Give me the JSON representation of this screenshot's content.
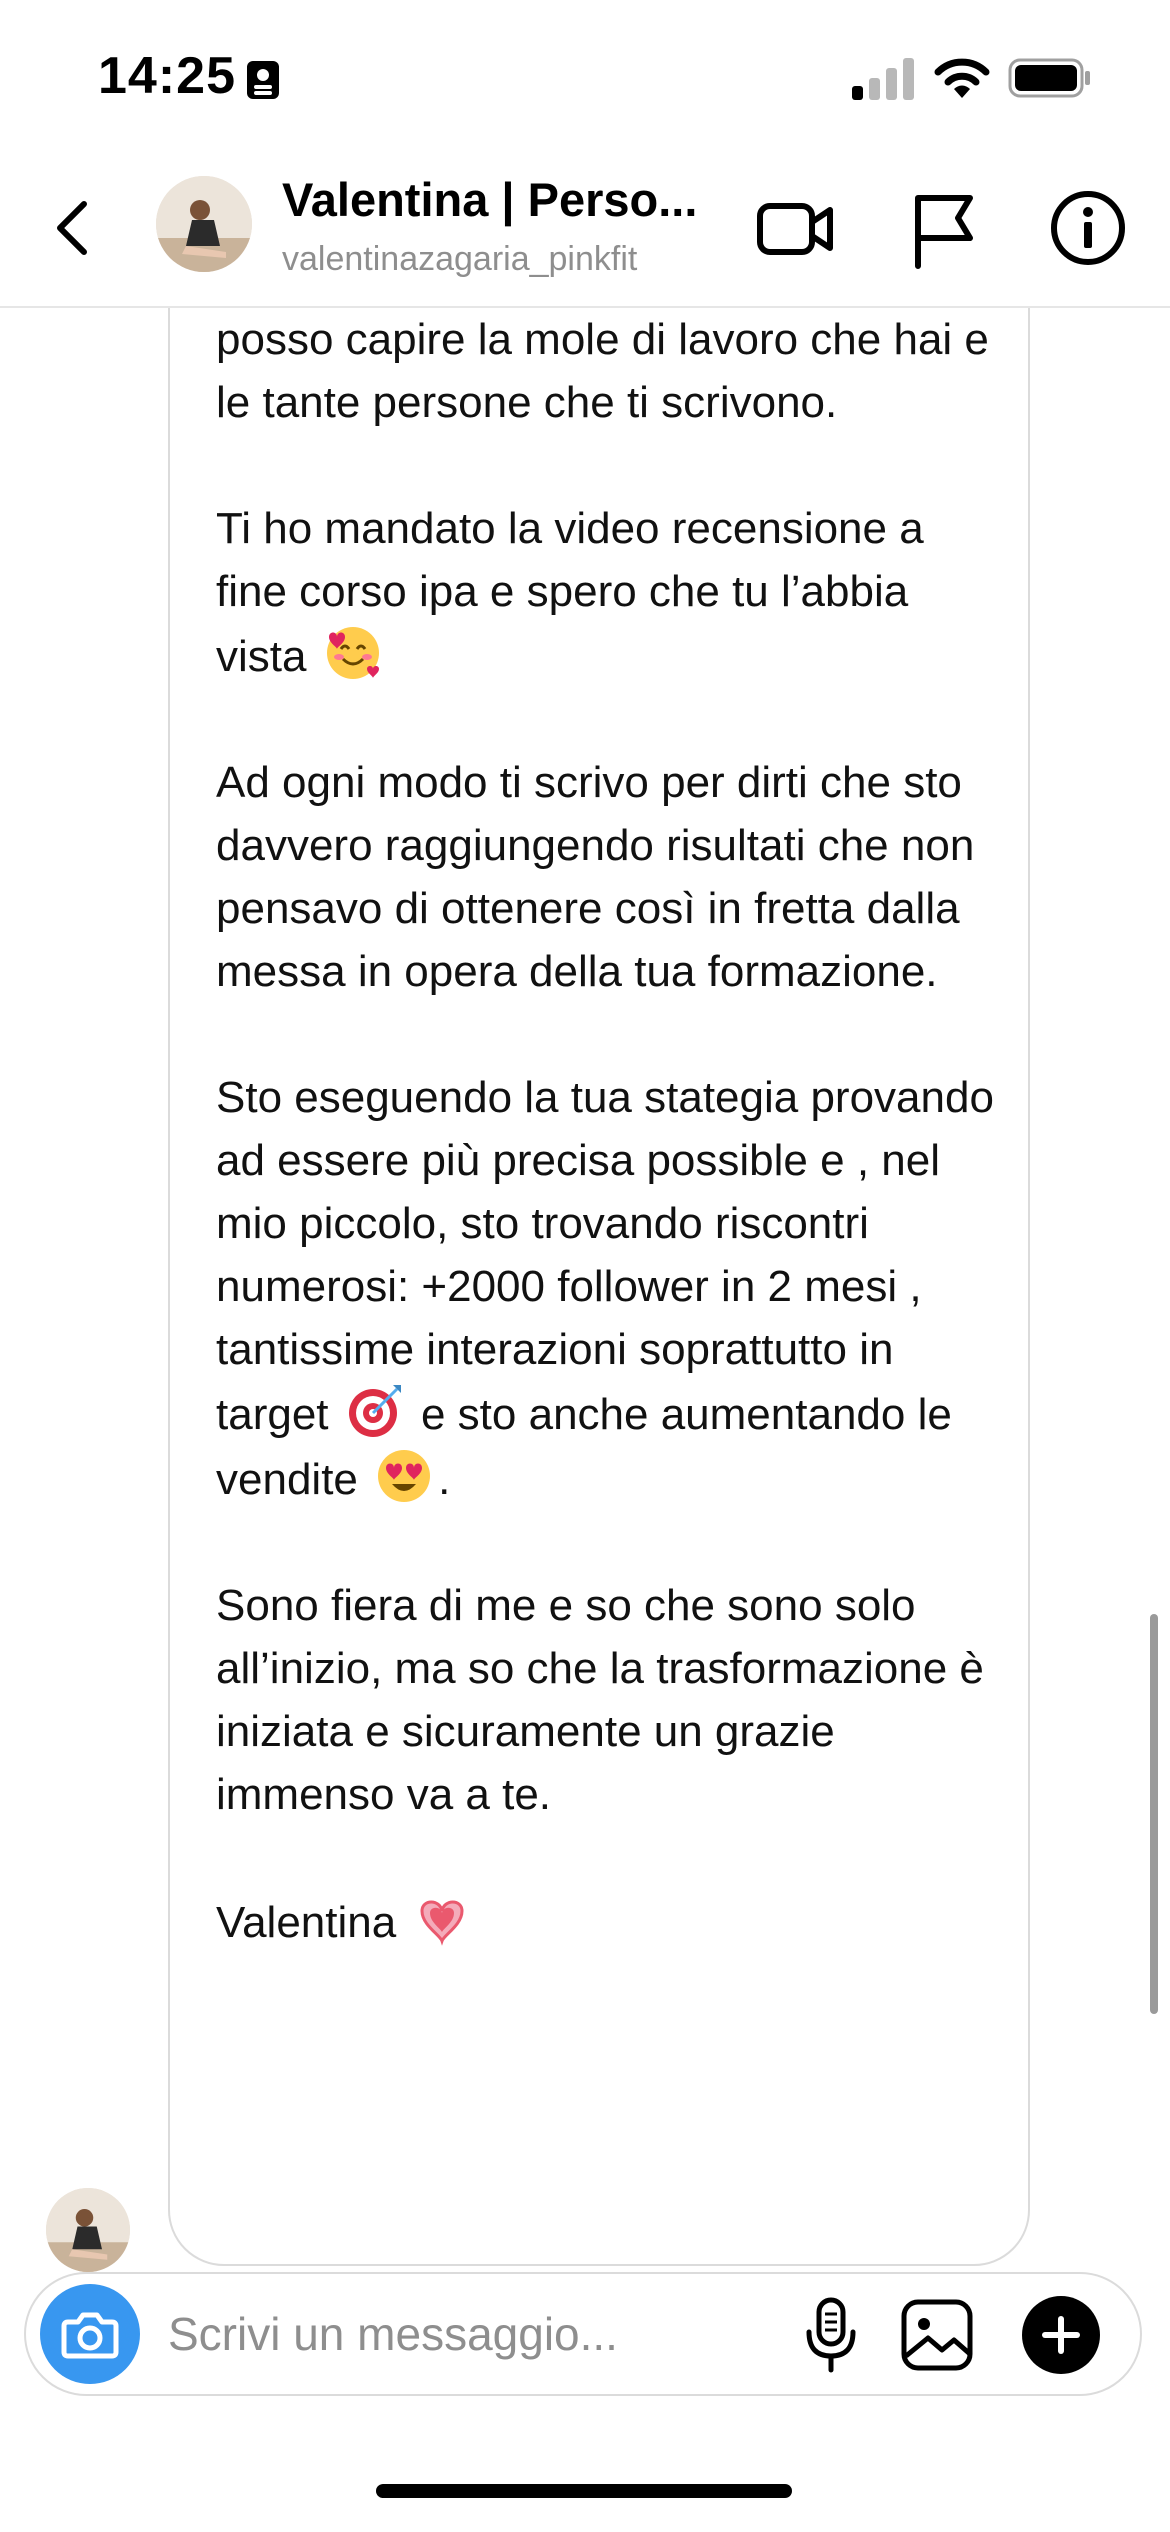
{
  "status_bar": {
    "time": "14:25",
    "contact_card_icon": "contact-card-icon",
    "signal_icon": "cellular-signal-icon",
    "wifi_icon": "wifi-icon",
    "battery_icon": "battery-icon"
  },
  "header": {
    "name": "Valentina | Perso...",
    "username": "valentinazagaria_pinkfit",
    "back_icon": "chevron-left-icon",
    "video_icon": "video-camera-icon",
    "report_icon": "flag-icon",
    "info_icon": "info-icon"
  },
  "message": {
    "paragraphs": [
      {
        "text": "posso capire la mole di lavoro che hai e le tante persone che ti scrivono."
      },
      {
        "text": "Ti ho mandato la video recensione a fine corso ipa e spero che tu l’abbia vista",
        "emoji": "smiling-face-with-hearts"
      },
      {
        "text": "Ad ogni modo ti scrivo per dirti che sto davvero raggiungendo risultati che non pensavo di ottenere così in fretta dalla messa in opera della tua formazione."
      },
      {
        "text_before": "Sto eseguendo la tua stategia provando ad essere più precisa possible e , nel mio piccolo, sto trovando riscontri numerosi: +2000 follower in 2 mesi , tantissime interazioni soprattutto in target",
        "emoji_1": "direct-hit",
        "text_middle": "e sto anche aumentando le vendite",
        "emoji_2": "heart-eyes",
        "text_after": "."
      },
      {
        "text": "Sono fiera di me e so che sono solo all’inizio, ma so che la trasformazione è iniziata e sicuramente un grazie immenso va a te."
      },
      {
        "text": "Valentina",
        "emoji": "growing-heart"
      }
    ]
  },
  "composer": {
    "placeholder": "Scrivi un messaggio...",
    "camera_icon": "camera-icon",
    "microphone_icon": "microphone-icon",
    "gallery_icon": "gallery-icon",
    "add_icon": "plus-icon"
  },
  "colors": {
    "accent": "#3897f0",
    "secondary_text": "#8e8e8e",
    "border": "#dbdbdb"
  }
}
